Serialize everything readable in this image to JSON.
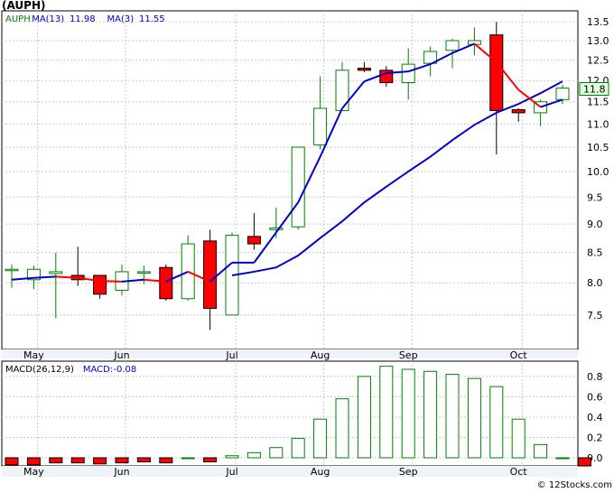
{
  "title": "(AUPH)",
  "footer": "© 12Stocks.com",
  "chart_data": [
    {
      "type": "candlestick",
      "ticker": "AUPH",
      "legend": [
        {
          "label": "AUPH",
          "value": "",
          "color": "#008000"
        },
        {
          "label": "MA(13)",
          "value": "11.98",
          "color": "#0000cc"
        },
        {
          "label": "MA(3)",
          "value": "11.55",
          "color": "#0000cc"
        }
      ],
      "last_price_label": "11.8",
      "x_labels": [
        "May",
        "Jun",
        "Jul",
        "Aug",
        "Sep",
        "Oct"
      ],
      "x_label_index": [
        1,
        5,
        10,
        14,
        18,
        23
      ],
      "y_ticks": [
        "7.5",
        "8.0",
        "8.5",
        "9.0",
        "9.5",
        "10.0",
        "10.5",
        "11.0",
        "11.5",
        "12.0",
        "12.5",
        "13.0",
        "13.5"
      ],
      "ylim": [
        7.0,
        13.8
      ],
      "log_scale": true,
      "grid": true,
      "candles": [
        {
          "o": 8.22,
          "h": 8.3,
          "l": 7.92,
          "c": 8.22
        },
        {
          "o": 8.05,
          "h": 8.28,
          "l": 7.9,
          "c": 8.22
        },
        {
          "o": 8.15,
          "h": 8.5,
          "l": 7.45,
          "c": 8.18
        },
        {
          "o": 8.12,
          "h": 8.6,
          "l": 7.95,
          "c": 8.05
        },
        {
          "o": 8.12,
          "h": 8.12,
          "l": 7.75,
          "c": 7.82
        },
        {
          "o": 7.88,
          "h": 8.3,
          "l": 7.8,
          "c": 8.18
        },
        {
          "o": 8.18,
          "h": 8.28,
          "l": 7.98,
          "c": 8.18
        },
        {
          "o": 8.25,
          "h": 8.3,
          "l": 7.72,
          "c": 7.75
        },
        {
          "o": 7.75,
          "h": 8.8,
          "l": 7.72,
          "c": 8.65
        },
        {
          "o": 8.7,
          "h": 8.9,
          "l": 7.28,
          "c": 7.6
        },
        {
          "o": 7.5,
          "h": 8.85,
          "l": 7.5,
          "c": 8.8
        },
        {
          "o": 8.78,
          "h": 9.2,
          "l": 8.55,
          "c": 8.65
        },
        {
          "o": 8.9,
          "h": 9.3,
          "l": 8.75,
          "c": 8.93
        },
        {
          "o": 8.95,
          "h": 10.5,
          "l": 8.9,
          "c": 10.5
        },
        {
          "o": 10.55,
          "h": 12.1,
          "l": 10.45,
          "c": 11.35
        },
        {
          "o": 11.3,
          "h": 12.45,
          "l": 11.3,
          "c": 12.25
        },
        {
          "o": 12.3,
          "h": 12.45,
          "l": 12.2,
          "c": 12.25
        },
        {
          "o": 12.25,
          "h": 12.35,
          "l": 11.85,
          "c": 11.95
        },
        {
          "o": 11.95,
          "h": 12.8,
          "l": 11.55,
          "c": 12.4
        },
        {
          "o": 12.42,
          "h": 12.85,
          "l": 12.1,
          "c": 12.72
        },
        {
          "o": 12.75,
          "h": 13.05,
          "l": 12.3,
          "c": 13.0
        },
        {
          "o": 12.9,
          "h": 13.35,
          "l": 12.62,
          "c": 13.0
        },
        {
          "o": 13.15,
          "h": 13.5,
          "l": 10.35,
          "c": 11.3
        },
        {
          "o": 11.32,
          "h": 11.35,
          "l": 11.05,
          "c": 11.25
        },
        {
          "o": 11.25,
          "h": 11.55,
          "l": 10.95,
          "c": 11.5
        },
        {
          "o": 11.55,
          "h": 11.9,
          "l": 11.45,
          "c": 11.82
        }
      ],
      "ma3_color_down": "#ff0000",
      "ma3_color_up": "#0000cc",
      "ma13_color": "#0000cc",
      "ma3": [
        8.05,
        8.08,
        8.1,
        8.08,
        8.03,
        8.02,
        8.05,
        8.02,
        8.18,
        8.02,
        8.33,
        8.33,
        8.85,
        9.4,
        10.3,
        11.35,
        11.98,
        12.18,
        12.22,
        12.4,
        12.68,
        12.92,
        12.45,
        11.78,
        11.38,
        11.55
      ],
      "ma13": [
        null,
        null,
        null,
        null,
        null,
        null,
        null,
        null,
        null,
        null,
        8.12,
        8.18,
        8.25,
        8.45,
        8.75,
        9.05,
        9.4,
        9.7,
        10.0,
        10.3,
        10.65,
        10.98,
        11.25,
        11.45,
        11.7,
        11.98
      ]
    },
    {
      "type": "bar",
      "title": "MACD(26,12,9)",
      "legend": [
        {
          "label": "MACD(26,12,9)",
          "value": "",
          "color": "#000000"
        },
        {
          "label": "MACD:",
          "value": "-0.08",
          "color": "#0000cc"
        }
      ],
      "x_labels": [
        "May",
        "Jun",
        "Jul",
        "Aug",
        "Sep",
        "Oct"
      ],
      "y_ticks": [
        "0.0",
        "0.2",
        "0.4",
        "0.6",
        "0.8"
      ],
      "ylim": [
        -0.08,
        0.95
      ],
      "grid": true,
      "values": [
        -0.07,
        -0.07,
        -0.05,
        -0.05,
        -0.06,
        -0.05,
        -0.04,
        -0.05,
        0.0,
        -0.04,
        0.02,
        0.05,
        0.1,
        0.19,
        0.38,
        0.58,
        0.8,
        0.9,
        0.87,
        0.85,
        0.82,
        0.78,
        0.7,
        0.38,
        0.13,
        0.0,
        -0.08
      ],
      "positive_color": "#008000",
      "negative_color": "#ff0000"
    }
  ]
}
